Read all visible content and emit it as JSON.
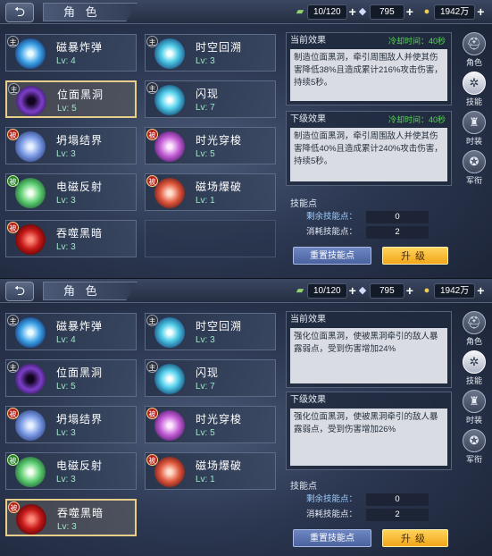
{
  "header": {
    "title": "角 色",
    "stamina": "10/120",
    "diamond": "795",
    "gold": "1942万"
  },
  "skills_top": [
    {
      "name": "磁暴炸弹",
      "level": "Lv: 4",
      "tag": "主"
    },
    {
      "name": "时空回溯",
      "level": "Lv: 3",
      "tag": "主"
    },
    {
      "name": "位面黑洞",
      "level": "Lv: 5",
      "tag": "主"
    },
    {
      "name": "闪现",
      "level": "Lv: 7",
      "tag": "主"
    },
    {
      "name": "坍塌结界",
      "level": "Lv: 3",
      "tag": "被"
    },
    {
      "name": "时光穿梭",
      "level": "Lv: 5",
      "tag": "被"
    },
    {
      "name": "电磁反射",
      "level": "Lv: 3",
      "tag": "被"
    },
    {
      "name": "磁场爆破",
      "level": "Lv: 1",
      "tag": "被"
    },
    {
      "name": "吞噬黑暗",
      "level": "Lv: 3",
      "tag": "被"
    }
  ],
  "skills_bottom": [
    {
      "name": "磁暴炸弹",
      "level": "Lv: 4",
      "tag": "主"
    },
    {
      "name": "时空回溯",
      "level": "Lv: 3",
      "tag": "主"
    },
    {
      "name": "位面黑洞",
      "level": "Lv: 5",
      "tag": "主"
    },
    {
      "name": "闪现",
      "level": "Lv: 7",
      "tag": "主"
    },
    {
      "name": "坍塌结界",
      "level": "Lv: 3",
      "tag": "被"
    },
    {
      "name": "时光穿梭",
      "level": "Lv: 5",
      "tag": "被"
    },
    {
      "name": "电磁反射",
      "level": "Lv: 3",
      "tag": "被"
    },
    {
      "name": "磁场爆破",
      "level": "Lv: 1",
      "tag": "被"
    },
    {
      "name": "吞噬黑暗",
      "level": "Lv: 3",
      "tag": "被"
    }
  ],
  "panel_top": {
    "current_label": "当前效果",
    "current_cd": "冷却时间：40秒",
    "current_desc": "制造位面黑洞，牵引周围敌人并使其伤害降低38%且造成累计216%攻击伤害，持续5秒。",
    "next_label": "下级效果",
    "next_cd": "冷却时间：40秒",
    "next_desc": "制造位面黑洞，牵引周围敌人并使其伤害降低40%且造成累计240%攻击伤害，持续5秒。",
    "sp_label": "技能点",
    "remain_label": "剩余技能点：",
    "remain_value": "0",
    "cost_label": "消耗技能点：",
    "cost_value": "2",
    "reset_label": "重置技能点",
    "upgrade_label": "升级"
  },
  "panel_bottom": {
    "current_label": "当前效果",
    "current_desc": "强化位面黑洞，使被黑洞牵引的敌人暴露弱点，受到伤害增加24%",
    "next_label": "下级效果",
    "next_desc": "强化位面黑洞，使被黑洞牵引的敌人暴露弱点，受到伤害增加26%",
    "sp_label": "技能点",
    "remain_label": "剩余技能点：",
    "remain_value": "0",
    "cost_label": "消耗技能点：",
    "cost_value": "2",
    "reset_label": "重置技能点",
    "upgrade_label": "升级"
  },
  "side_tabs": [
    {
      "label": "角色",
      "icon": "helmet-icon"
    },
    {
      "label": "技能",
      "icon": "skill-gear-icon"
    },
    {
      "label": "时装",
      "icon": "costume-icon"
    },
    {
      "label": "军衔",
      "icon": "rank-medal-icon"
    }
  ]
}
